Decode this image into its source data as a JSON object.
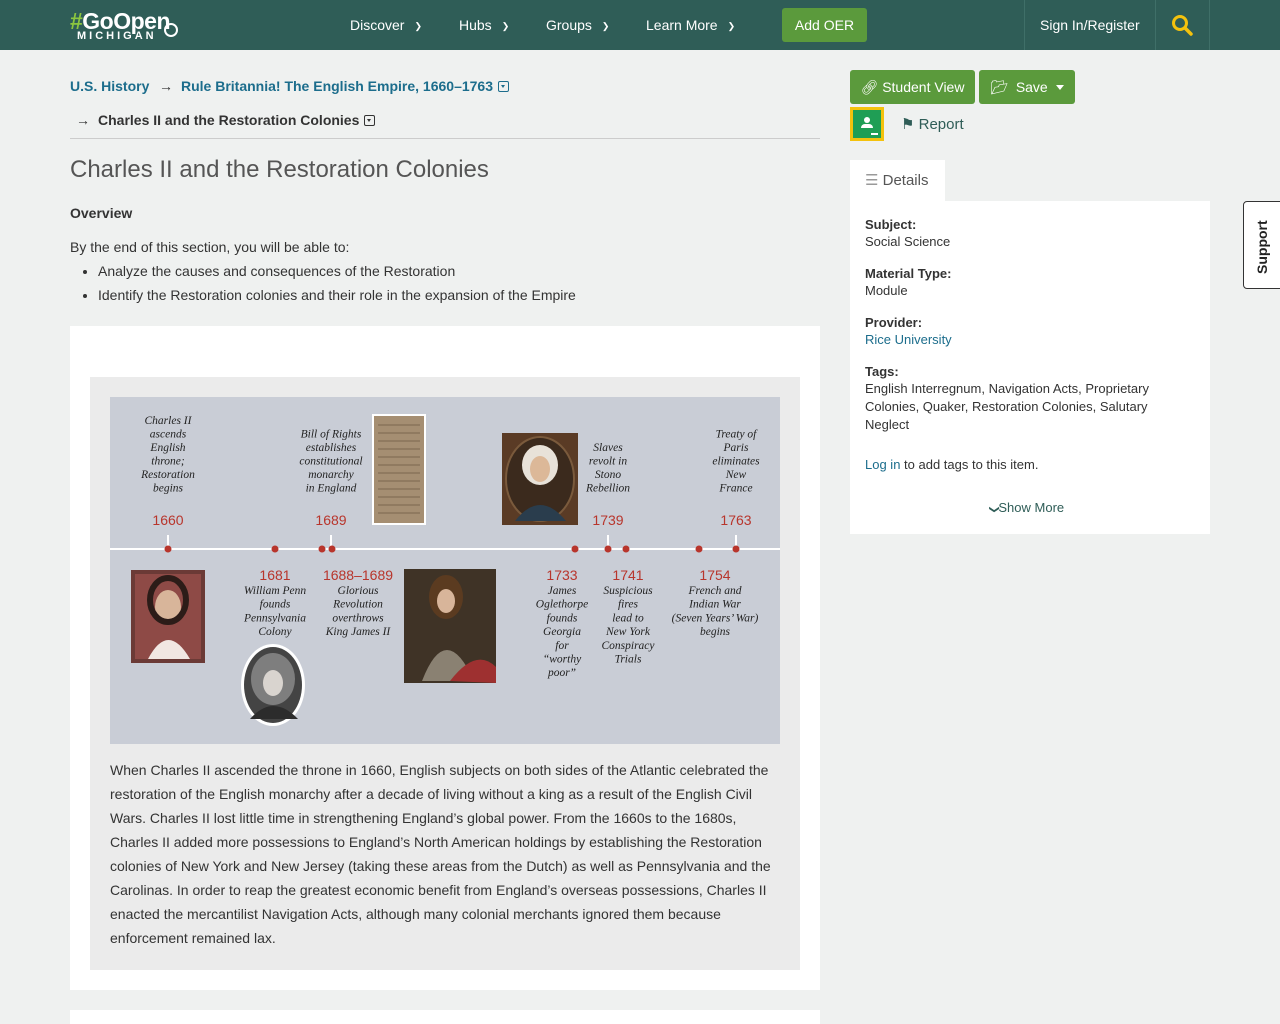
{
  "nav": {
    "logo_hash": "#",
    "logo_brand": "GoOpen",
    "logo_sub": "MICHIGAN",
    "items": [
      {
        "label": "Discover"
      },
      {
        "label": "Hubs"
      },
      {
        "label": "Groups"
      },
      {
        "label": "Learn More"
      }
    ],
    "add_oer": "Add OER",
    "sign_in": "Sign In/Register",
    "search_icon": "search-icon"
  },
  "breadcrumb": {
    "root": "U.S. History",
    "arrow": "→",
    "level1": "Rule Britannia! The English Empire, 1660–1763",
    "level2": "Charles II and the Restoration Colonies"
  },
  "page": {
    "title": "Charles II and the Restoration Colonies",
    "overview_heading": "Overview",
    "intro": "By the end of this section, you will be able to:",
    "objectives": [
      "Analyze the causes and consequences of the Restoration",
      "Identify the Restoration colonies and their role in the expansion of the Empire"
    ]
  },
  "timeline": {
    "above": [
      {
        "year": "1660",
        "text": [
          "Charles II",
          "ascends",
          "English",
          "throne;",
          "Restoration",
          "begins"
        ]
      },
      {
        "year": "1689",
        "text": [
          "Bill of Rights",
          "establishes",
          "constitutional",
          "monarchy",
          "in England"
        ]
      },
      {
        "year": "1739",
        "text": [
          "Slaves",
          "revolt in",
          "Stono",
          "Rebellion"
        ]
      },
      {
        "year": "1763",
        "text": [
          "Treaty of",
          "Paris",
          "eliminates",
          "New",
          "France"
        ]
      }
    ],
    "below": [
      {
        "year": "1681",
        "text": [
          "William Penn",
          "founds",
          "Pennsylvania",
          "Colony"
        ]
      },
      {
        "year": "1688–1689",
        "text": [
          "Glorious",
          "Revolution",
          "overthrows",
          "King James II"
        ]
      },
      {
        "year": "1733",
        "text": [
          "James",
          "Oglethorpe",
          "founds",
          "Georgia",
          "for",
          "“worthy",
          "poor”"
        ]
      },
      {
        "year": "1741",
        "text": [
          "Suspicious",
          "fires",
          "lead to",
          "New York",
          "Conspiracy",
          "Trials"
        ]
      },
      {
        "year": "1754",
        "text": [
          "French and",
          "Indian War",
          "(Seven Years’ War)",
          "begins"
        ]
      }
    ]
  },
  "caption": "When Charles II ascended the throne in 1660, English subjects on both sides of the Atlantic celebrated the restoration of the English monarchy after a decade of living without a king as a result of the English Civil Wars. Charles II lost little time in strengthening England’s global power. From the 1660s to the 1680s, Charles II added more possessions to England’s North American holdings by establishing the Restoration colonies of New York and New Jersey (taking these areas from the Dutch) as well as Pennsylvania and the Carolinas. In order to reap the greatest economic benefit from England’s overseas possessions, Charles II enacted the mercantilist Navigation Acts, although many colonial merchants ignored them because enforcement remained lax.",
  "sidebar": {
    "student_view": "Student View",
    "save": "Save",
    "report": "Report",
    "details_tab": "Details",
    "subject_label": "Subject:",
    "subject": "Social Science",
    "material_label": "Material Type:",
    "material": "Module",
    "provider_label": "Provider:",
    "provider": "Rice University",
    "tags_label": "Tags:",
    "tags": "English Interregnum, Navigation Acts, Proprietary Colonies, Quaker, Restoration Colonies, Salutary Neglect",
    "login": "Log in",
    "login_suffix": " to add tags to this item.",
    "show_more": "Show More",
    "support": "Support"
  },
  "colors": {
    "navbar": "#2f5d57",
    "button_green": "#5b9a3c",
    "link": "#1c6d8c",
    "timeline_bg": "#c9cdd6",
    "timeline_year": "#b8352c"
  }
}
